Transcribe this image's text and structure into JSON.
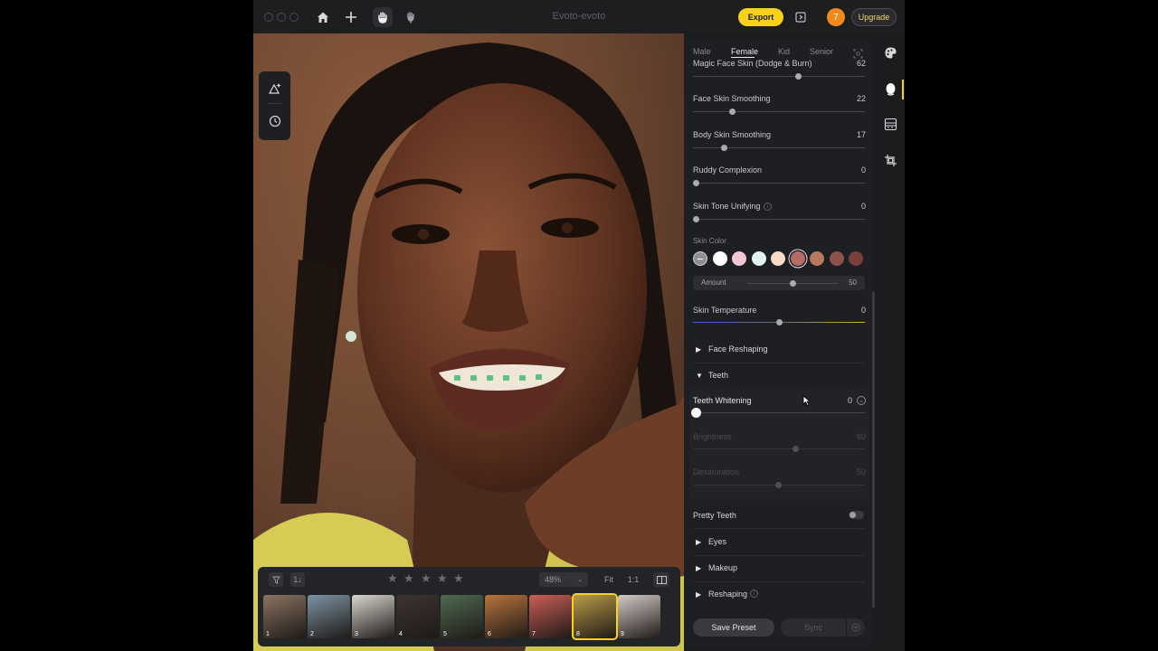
{
  "window": {
    "title": "Evoto-evoto"
  },
  "toolbar": {
    "export_label": "Export",
    "badge_count": "7",
    "upgrade_label": "Upgrade",
    "icons": [
      "home-icon",
      "plus-icon",
      "hand-icon",
      "hand-pointer-icon",
      "export-panel-icon"
    ]
  },
  "left_tools": [
    "magic-adjust-icon",
    "history-icon"
  ],
  "gender_tabs": [
    {
      "label": "Male",
      "active": false
    },
    {
      "label": "Female",
      "active": true
    },
    {
      "label": "Kid",
      "active": false
    },
    {
      "label": "Senior",
      "active": false
    }
  ],
  "sliders": [
    {
      "label": "Magic Face Skin (Dodge & Burn)",
      "value": "62",
      "pos": 0.62
    },
    {
      "label": "Face Skin Smoothing",
      "value": "22",
      "pos": 0.22
    },
    {
      "label": "Body Skin Smoothing",
      "value": "17",
      "pos": 0.17
    },
    {
      "label": "Ruddy Complexion",
      "value": "0",
      "pos": 0
    },
    {
      "label": "Skin Tone Unifying",
      "value": "0",
      "pos": 0
    }
  ],
  "skin_color": {
    "label": "Skin Color",
    "swatches": [
      "#8f8f92",
      "#ffffff",
      "#f2c7d3",
      "#dff4f3",
      "#f6dcc4",
      "#b56c68",
      "#b9775d",
      "#8f5249",
      "#7a3f3a"
    ],
    "amount_label": "Amount",
    "amount_value": "50",
    "amount_pos": 0.5
  },
  "skin_temperature": {
    "label": "Skin Temperature",
    "value": "0",
    "pos": 0.5
  },
  "face_reshaping": {
    "label": "Face Reshaping"
  },
  "teeth": {
    "label": "Teeth",
    "whitening": {
      "label": "Teeth Whitening",
      "value": "0",
      "pos": 0
    },
    "brightness": {
      "label": "Brightness",
      "value": "60",
      "pos": 0.6
    },
    "desaturation": {
      "label": "Desaturation",
      "value": "50",
      "pos": 0.5
    }
  },
  "pretty_teeth": {
    "label": "Pretty Teeth",
    "on": false
  },
  "eyes": {
    "label": "Eyes"
  },
  "makeup": {
    "label": "Makeup"
  },
  "reshaping": {
    "label": "Reshaping"
  },
  "actions": {
    "save_preset": "Save Preset",
    "sync": "Sync"
  },
  "bottom_bar": {
    "zoom": "48%",
    "fit": "Fit",
    "one_to_one": "1:1",
    "sort_label": "1↓",
    "stars": 5,
    "thumbnails": [
      {
        "num": "1",
        "color": "#8a7462"
      },
      {
        "num": "2",
        "color": "#7d94a4"
      },
      {
        "num": "3",
        "color": "#d9d6cf"
      },
      {
        "num": "4",
        "color": "#3d3430"
      },
      {
        "num": "5",
        "color": "#4f6a51"
      },
      {
        "num": "6",
        "color": "#b8743c"
      },
      {
        "num": "7",
        "color": "#c95f57"
      },
      {
        "num": "8",
        "color": "#b99b48"
      },
      {
        "num": "9",
        "color": "#d4cbc7"
      }
    ],
    "selected_index": 7
  },
  "rail": [
    "palette-icon",
    "face-retouch-icon",
    "background-icon",
    "crop-icon"
  ]
}
